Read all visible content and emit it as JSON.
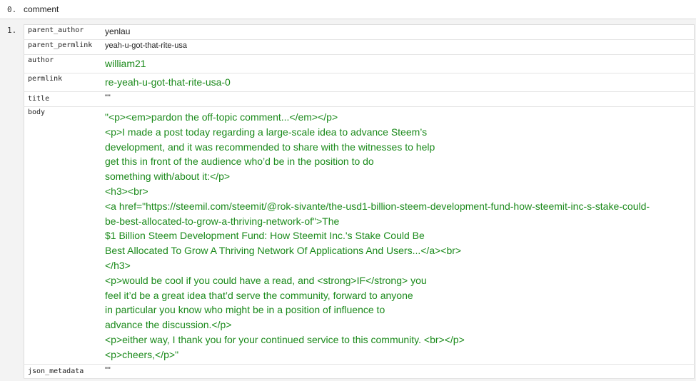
{
  "operations": [
    {
      "index": "0.",
      "name": "comment"
    },
    {
      "index": "1."
    }
  ],
  "fields": {
    "parent_author": {
      "key": "parent_author",
      "value": "yenlau"
    },
    "parent_permlink": {
      "key": "parent_permlink",
      "value": "yeah-u-got-that-rite-usa"
    },
    "author": {
      "key": "author",
      "value": "william21"
    },
    "permlink": {
      "key": "permlink",
      "value": "re-yeah-u-got-that-rite-usa-0"
    },
    "title": {
      "key": "title",
      "value": "\"\""
    },
    "body": {
      "key": "body",
      "lines": [
        "\"<p><em>pardon the off-topic comment...</em></p>",
        "<p>I made a post today regarding a large-scale idea to advance Steem’s",
        "development, and it was recommended to share with the witnesses to help",
        "get this in front of the audience who’d be in the position to do",
        "something with/about it:</p>",
        "<h3><br>",
        "<a href=\"https://steemil.com/steemit/@rok-sivante/the-usd1-billion-steem-development-fund-how-steemit-inc-s-stake-could-",
        "be-best-allocated-to-grow-a-thriving-network-of\">The",
        "$1 Billion Steem Development Fund: How Steemit Inc.'s Stake Could Be",
        "Best Allocated To Grow A Thriving Network Of Applications And Users...</a><br>",
        "</h3>",
        "<p>would be cool if you could have a read, and <strong>IF</strong> you",
        "feel it’d be a great idea that’d serve the community, forward to anyone",
        "in particular you know who might be in a position of influence to",
        "advance the discussion.</p>",
        "<p>either way, I thank you for your continued service to this community. <br></p>",
        "<p>cheers,</p>\""
      ]
    },
    "json_metadata": {
      "key": "json_metadata",
      "value": "\"\""
    }
  }
}
